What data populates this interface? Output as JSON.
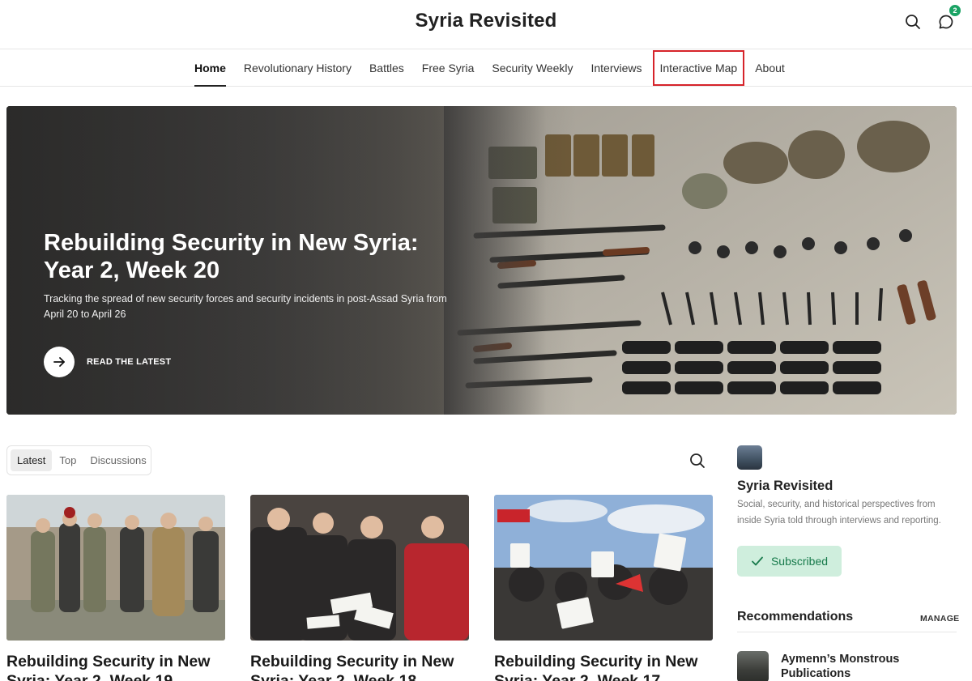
{
  "header": {
    "site_title": "Syria Revisited",
    "notification_count": "2"
  },
  "nav": {
    "items": [
      {
        "label": "Home"
      },
      {
        "label": "Revolutionary History"
      },
      {
        "label": "Battles"
      },
      {
        "label": "Free Syria"
      },
      {
        "label": "Security Weekly"
      },
      {
        "label": "Interviews"
      },
      {
        "label": "Interactive Map"
      },
      {
        "label": "About"
      }
    ]
  },
  "hero": {
    "title": "Rebuilding Security in New Syria: Year 2, Week 20",
    "subtitle": "Tracking the spread of new security forces and security incidents in post-Assad Syria from April 20 to April 26",
    "cta_label": "READ THE LATEST"
  },
  "tabs": {
    "items": [
      {
        "label": "Latest"
      },
      {
        "label": "Top"
      },
      {
        "label": "Discussions"
      }
    ]
  },
  "posts": [
    {
      "title": "Rebuilding Security in New Syria: Year 2, Week 19"
    },
    {
      "title": "Rebuilding Security in New Syria: Year 2, Week 18"
    },
    {
      "title": "Rebuilding Security in New Syria: Year 2, Week 17"
    }
  ],
  "sidebar": {
    "name": "Syria Revisited",
    "description": "Social, security, and historical perspectives from inside Syria told through interviews and reporting.",
    "subscribed_label": "Subscribed",
    "recommendations_title": "Recommendations",
    "manage_label": "MANAGE",
    "recommendations": [
      {
        "name": "Aymenn’s Monstrous Publications"
      }
    ]
  },
  "colors": {
    "accent_green": "#1aa364",
    "subscribed_bg": "#cfeedd",
    "highlight_red": "#d6232a"
  }
}
